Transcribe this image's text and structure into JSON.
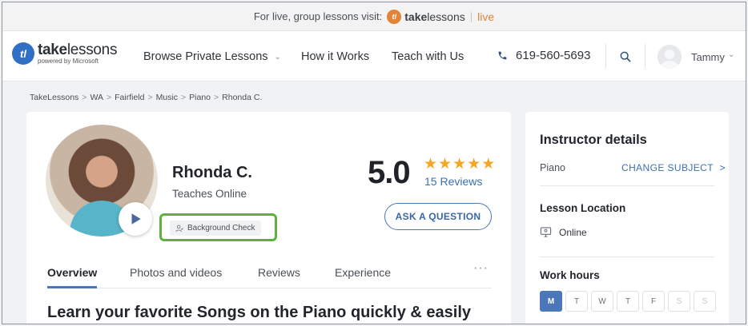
{
  "promo": {
    "text": "For live, group lessons visit:",
    "logo_mark": "tl",
    "brand_bold": "take",
    "brand_rest": "lessons",
    "separator": "|",
    "live": "live"
  },
  "nav": {
    "logo_mark": "tl",
    "logo_bold": "take",
    "logo_rest": "lessons",
    "logo_sub": "powered by Microsoft",
    "items": [
      {
        "label": "Browse Private Lessons",
        "has_dropdown": true
      },
      {
        "label": "How it Works"
      },
      {
        "label": "Teach with Us"
      }
    ],
    "phone": "619-560-5693",
    "user": "Tammy",
    "icons": {
      "phone": "phone-icon",
      "search": "search-icon",
      "chevron": "chevron-down-icon"
    }
  },
  "breadcrumb": [
    "TakeLessons",
    "WA",
    "Fairfield",
    "Music",
    "Piano",
    "Rhonda C."
  ],
  "breadcrumb_separator": ">",
  "profile": {
    "name": "Rhonda C.",
    "teaches": "Teaches Online",
    "badge": "Background Check",
    "rating": "5.0",
    "stars": 5,
    "reviews": "15 Reviews",
    "ask_button": "ASK A QUESTION",
    "tabs": [
      "Overview",
      "Photos and videos",
      "Reviews",
      "Experience"
    ],
    "active_tab": "Overview",
    "more": "···",
    "headline": "Learn your favorite Songs on the Piano quickly & easily"
  },
  "details": {
    "title": "Instructor details",
    "subject": "Piano",
    "change_subject": "CHANGE SUBJECT",
    "change_chevron": ">",
    "location_title": "Lesson Location",
    "location": "Online",
    "hours_title": "Work hours",
    "days": [
      {
        "label": "M",
        "state": "selected"
      },
      {
        "label": "T",
        "state": "available"
      },
      {
        "label": "W",
        "state": "available"
      },
      {
        "label": "T",
        "state": "available"
      },
      {
        "label": "F",
        "state": "available"
      },
      {
        "label": "S",
        "state": "unavailable"
      },
      {
        "label": "S",
        "state": "unavailable"
      }
    ]
  },
  "colors": {
    "brand_blue": "#2f6fc4",
    "accent_blue": "#4b76b8",
    "live_orange": "#e1843a",
    "star": "#f5a623",
    "highlight_green": "#5db23c"
  }
}
